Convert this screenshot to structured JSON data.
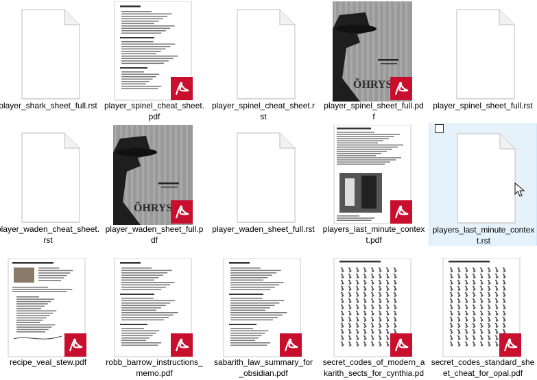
{
  "files": [
    {
      "name": "player_shark_sheet_full.rst",
      "label": "player_shark_sheet_full.rst",
      "kind": "blank"
    },
    {
      "name": "player_spinel_cheat_sheet.pdf",
      "label": "player_spinel_cheat_sheet.\npdf",
      "kind": "pdf-text"
    },
    {
      "name": "player_spinel_cheat_sheet.rst",
      "label": "player_spinel_cheat_sheet.r\nst",
      "kind": "blank"
    },
    {
      "name": "player_spinel_sheet_full.pdf",
      "label": "player_spinel_sheet_full.pd\nf",
      "kind": "pdf-photo"
    },
    {
      "name": "player_spinel_sheet_full.rst",
      "label": "player_spinel_sheet_full.rst",
      "kind": "blank"
    },
    {
      "name": "player_waden_cheat_sheet.rst",
      "label": "player_waden_cheat_sheet.\nrst",
      "kind": "blank"
    },
    {
      "name": "player_waden_sheet_full.pdf",
      "label": "player_waden_sheet_full.p\ndf",
      "kind": "pdf-photo"
    },
    {
      "name": "player_waden_sheet_full.rst",
      "label": "player_waden_sheet_full.rst",
      "kind": "blank"
    },
    {
      "name": "players_last_minute_context.pdf",
      "label": "players_last_minute_contex\nt.pdf",
      "kind": "pdf-article"
    },
    {
      "name": "players_last_minute_context.rst",
      "label": "players_last_minute_contex\nt.rst",
      "kind": "blank",
      "selected": true
    },
    {
      "name": "recipe_veal_stew.pdf",
      "label": "recipe_veal_stew.pdf",
      "kind": "pdf-recipe"
    },
    {
      "name": "robb_barrow_instructions_memo.pdf",
      "label": "robb_barrow_instructions_\nmemo.pdf",
      "kind": "pdf-text"
    },
    {
      "name": "sabarith_law_summary_for_obsidian.pdf",
      "label": "sabarith_law_summary_for\n_obsidian.pdf",
      "kind": "pdf-text"
    },
    {
      "name": "secret_codes_of_modern_akarith_sects_for_cynthia.pdf",
      "label": "secret_codes_of_modern_a\nkarith_sects_for_cynthia.pd",
      "kind": "pdf-glyphs"
    },
    {
      "name": "secret_codes_standard_sheet_cheat_for_opal.pdf",
      "label": "secret_codes_standard_she\net_cheat_for_opal.pdf",
      "kind": "pdf-glyphs"
    }
  ],
  "colors": {
    "selected_bg": "#e5f1fb",
    "pdf_badge": "#c8102e",
    "page_border": "#c8c8c8"
  },
  "icons": {
    "blank": "blank-document-icon",
    "pdf": "pdf-badge-icon",
    "cursor": "mouse-pointer-icon"
  }
}
